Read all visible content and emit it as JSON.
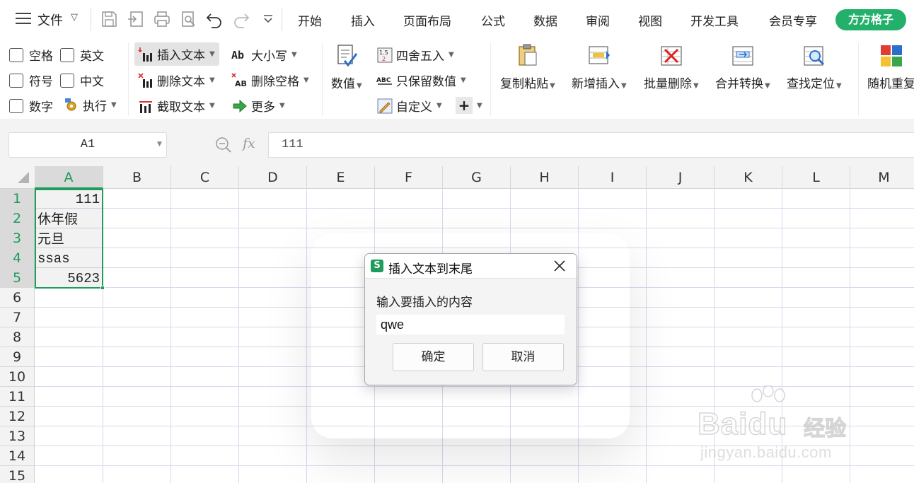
{
  "menubar": {
    "file_label": "文件",
    "tabs": [
      "开始",
      "插入",
      "页面布局",
      "公式",
      "数据",
      "审阅",
      "视图",
      "开发工具",
      "会员专享"
    ],
    "special_tab": "方方格子",
    "special_tab_color": "#23b06a"
  },
  "ribbon": {
    "checkboxes": [
      "空格",
      "英文",
      "符号",
      "中文",
      "数字"
    ],
    "execute": "执行",
    "text_group": {
      "insert_text": "插入文本",
      "delete_text": "删除文本",
      "cut_text": "截取文本"
    },
    "case_group": {
      "case": "大小写",
      "delete_spaces": "删除空格",
      "more": "更多"
    },
    "numeric": "数值",
    "rounding": "四舍五入",
    "keep_numeric": "只保留数值",
    "custom": "自定义",
    "big_buttons": [
      "复制粘贴",
      "新增插入",
      "批量删除",
      "合并转换",
      "查找定位",
      "随机重复"
    ]
  },
  "formula_bar": {
    "name_box": "A1",
    "fx_label": "fx",
    "content": "111"
  },
  "grid": {
    "columns": [
      "A",
      "B",
      "C",
      "D",
      "E",
      "F",
      "G",
      "H",
      "I",
      "J",
      "K",
      "L",
      "M"
    ],
    "rows": [
      "1",
      "2",
      "3",
      "4",
      "5",
      "6",
      "7",
      "8",
      "9",
      "10",
      "11",
      "12",
      "13",
      "14",
      "15"
    ],
    "cells": {
      "A1": "111",
      "A2": "休年假",
      "A3": "元旦",
      "A4": "ssas",
      "A5": "5623"
    },
    "selection_color": "#1f9b5c"
  },
  "dialog": {
    "title": "插入文本到末尾",
    "prompt": "输入要插入的内容",
    "input_value": "qwe",
    "ok_label": "确定",
    "cancel_label": "取消"
  },
  "watermark": {
    "brand": "Baidu",
    "brand_cn": "经验",
    "url": "jingyan.baidu.com"
  }
}
